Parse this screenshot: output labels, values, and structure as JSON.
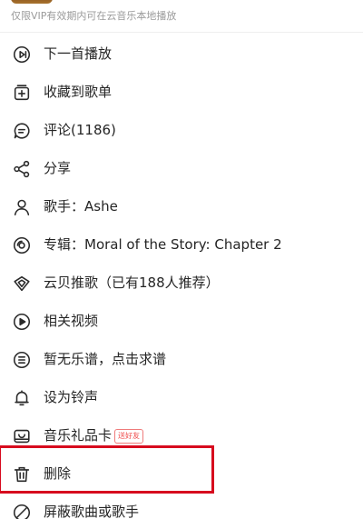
{
  "header": {
    "note": "仅限VIP有效期内可在云音乐本地播放"
  },
  "menu": {
    "items": [
      {
        "label": "下一首播放",
        "icon": "play-next-icon"
      },
      {
        "label": "收藏到歌单",
        "icon": "add-to-playlist-icon"
      },
      {
        "label": "评论(1186)",
        "icon": "comment-icon"
      },
      {
        "label": "分享",
        "icon": "share-icon"
      },
      {
        "label": "歌手：Ashe",
        "icon": "artist-icon"
      },
      {
        "label": "专辑：Moral of the Story: Chapter 2",
        "icon": "album-icon"
      },
      {
        "label": "云贝推歌（已有188人推荐）",
        "icon": "cloud-coin-recommend-icon"
      },
      {
        "label": "相关视频",
        "icon": "video-icon"
      },
      {
        "label": "暂无乐谱，点击求谱",
        "icon": "sheet-music-icon"
      },
      {
        "label": "设为铃声",
        "icon": "bell-icon"
      },
      {
        "label": "音乐礼品卡",
        "icon": "gift-card-icon",
        "badge": "送好友"
      },
      {
        "label": "删除",
        "icon": "trash-icon"
      },
      {
        "label": "屏蔽歌曲或歌手",
        "icon": "block-icon"
      }
    ]
  },
  "colors": {
    "highlight": "#d70a1e",
    "badge": "#ef4b4b",
    "text": "#252525",
    "note": "#9b9b9b"
  }
}
